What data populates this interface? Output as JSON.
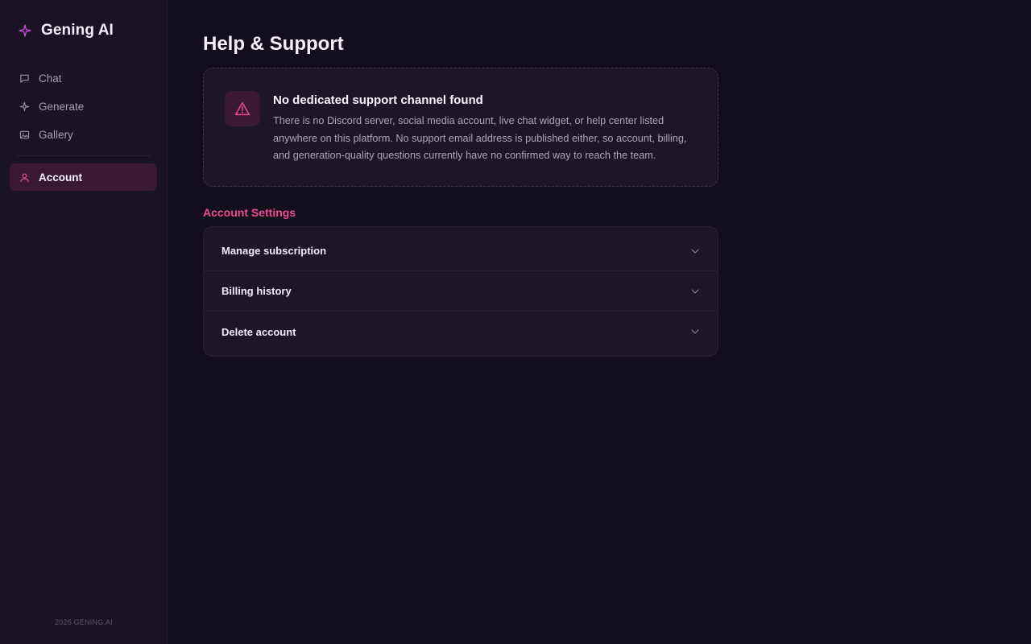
{
  "brand": {
    "name": "Gening AI",
    "icon": "sparkle-icon",
    "accent": "#c64bd8"
  },
  "sidebar": {
    "items": [
      {
        "label": "Chat",
        "icon": "chat-bubble-icon"
      },
      {
        "label": "Generate",
        "icon": "sparkle-icon"
      },
      {
        "label": "Gallery",
        "icon": "image-icon"
      },
      {
        "label": "Account",
        "icon": "user-icon",
        "active": true
      }
    ],
    "footer": "2026 GENING.AI"
  },
  "main": {
    "title": "Help & Support",
    "alert": {
      "icon": "warning-triangle-icon",
      "title": "No dedicated support channel found",
      "text": "There is no Discord server, social media account, live chat widget, or help center listed anywhere on this platform. No support email address is published either, so account, billing, and generation-quality questions currently have no confirmed way to reach the team."
    },
    "section_label": "Account Settings",
    "settings": [
      {
        "label": "Manage subscription",
        "icon": "chevron-down-icon"
      },
      {
        "label": "Billing history",
        "icon": "chevron-down-icon"
      },
      {
        "label": "Delete account",
        "icon": "chevron-down-icon"
      }
    ]
  },
  "colors": {
    "background": "#130e1c",
    "sidebar": "#1a1324",
    "accent_pink": "#ec4a98",
    "active_item": "#3a1834"
  }
}
